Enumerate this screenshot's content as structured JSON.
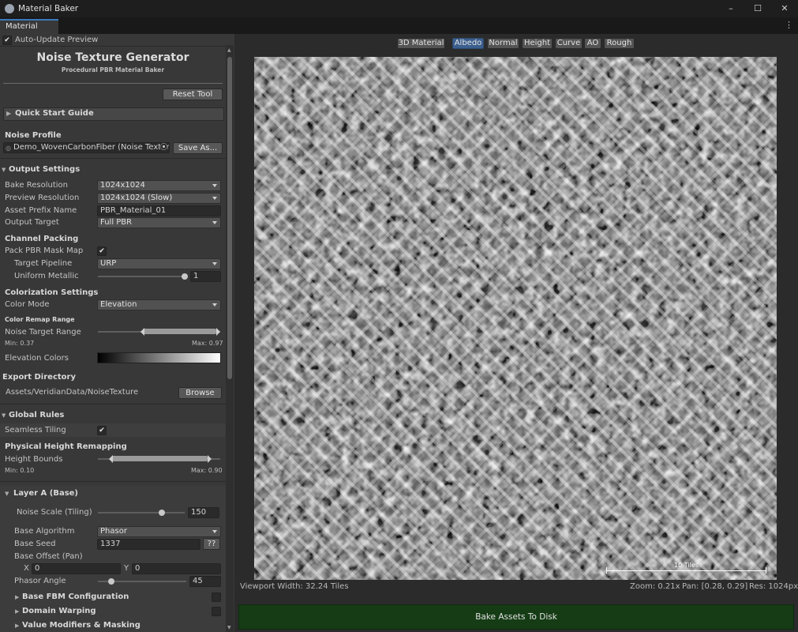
{
  "window": {
    "title": "Material Baker",
    "tab": "Material Baker"
  },
  "auto_update": {
    "label": "Auto-Update Preview",
    "checked": true
  },
  "header": {
    "title": "Noise Texture Generator",
    "subtitle": "Procedural PBR Material Baker",
    "reset_label": "Reset Tool"
  },
  "quick_start": {
    "label": "Quick Start Guide"
  },
  "noise_profile": {
    "heading": "Noise Profile",
    "value": "Demo_WovenCarbonFiber (Noise Texture",
    "save_as_label": "Save As..."
  },
  "output_settings": {
    "heading": "Output Settings",
    "bake_resolution": {
      "label": "Bake Resolution",
      "value": "1024x1024"
    },
    "preview_resolution": {
      "label": "Preview Resolution",
      "value": "1024x1024 (Slow)"
    },
    "asset_prefix": {
      "label": "Asset Prefix Name",
      "value": "PBR_Material_01"
    },
    "output_target": {
      "label": "Output Target",
      "value": "Full PBR"
    }
  },
  "channel_packing": {
    "heading": "Channel Packing",
    "pack_mask": {
      "label": "Pack PBR Mask Map",
      "checked": true
    },
    "target_pipeline": {
      "label": "Target Pipeline",
      "value": "URP"
    },
    "uniform_metallic": {
      "label": "Uniform Metallic",
      "value": "1",
      "fraction": 1.0
    }
  },
  "colorization": {
    "heading": "Colorization Settings",
    "color_mode": {
      "label": "Color Mode",
      "value": "Elevation"
    },
    "remap_heading": "Color Remap Range",
    "noise_target_range": {
      "label": "Noise Target Range",
      "min_text": "Min: 0.37",
      "max_text": "Max: 0.97",
      "min": 0.37,
      "max": 0.97
    },
    "elevation_colors": {
      "label": "Elevation Colors"
    }
  },
  "export_directory": {
    "heading": "Export Directory",
    "path": "Assets/VeridianData/NoiseTexture",
    "browse_label": "Browse"
  },
  "global_rules": {
    "heading": "Global Rules",
    "seamless_tiling": {
      "label": "Seamless Tiling",
      "checked": true
    },
    "height_remap_heading": "Physical Height Remapping",
    "height_bounds": {
      "label": "Height Bounds",
      "min_text": "Min: 0.10",
      "max_text": "Max: 0.90",
      "min": 0.1,
      "max": 0.9
    }
  },
  "layer_a": {
    "heading": "Layer A (Base)",
    "noise_scale": {
      "label": "Noise Scale (Tiling)",
      "value": "150",
      "fraction": 0.55
    },
    "base_algorithm": {
      "label": "Base Algorithm",
      "value": "Phasor"
    },
    "base_seed": {
      "label": "Base Seed",
      "value": "1337",
      "random_label": "??"
    },
    "base_offset": {
      "label": "Base Offset (Pan)",
      "x_label": "X",
      "x_value": "0",
      "y_label": "Y",
      "y_value": "0"
    },
    "phasor_angle": {
      "label": "Phasor Angle",
      "value": "45",
      "fraction": 0.05
    },
    "fbm": {
      "label": "Base FBM Configuration"
    },
    "domain_warping": {
      "label": "Domain Warping"
    },
    "value_modifiers": {
      "label": "Value Modifiers & Masking"
    }
  },
  "viewport": {
    "tabs": [
      "3D Material",
      "Albedo",
      "Normal",
      "Height",
      "Curve",
      "AO",
      "Rough"
    ],
    "active_tab": "Albedo",
    "scale_label": "10 Tiles",
    "width_text": "Viewport Width: 32.24 Tiles",
    "zoom_text": "Zoom: 0.21x",
    "pan_text": "Pan: [0.28, 0.29]",
    "res_text": "Res: 1024px"
  },
  "bake_button": {
    "label": "Bake Assets To Disk"
  },
  "colors": {
    "accent": "#3a79bb",
    "active_tab": "#3b5f8e",
    "bake": "#153c15"
  }
}
